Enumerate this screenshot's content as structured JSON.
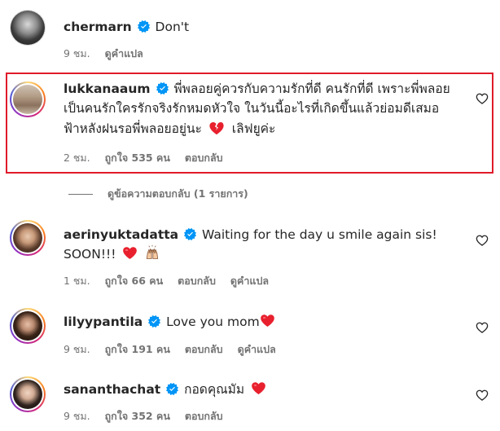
{
  "comments": [
    {
      "username": "chermarn",
      "text": "Don't",
      "time": "9 ชม.",
      "actions": [
        "ดูคำแปล"
      ]
    },
    {
      "username": "lukkanaaum",
      "text_lines": [
        "พี่พลอยคู่ควรกับความรักที่ดี คนรักที่ดี เพราะพี่พลอย",
        "เป็นคนรักใครรักจริงรักหมดหัวใจ ในวันนี้อะไรที่เกิดขึ้นแล้วย่อมดีเสมอ",
        "ฟ้าหลังฝนรอพี่พลอยอยู่นะ",
        "เลิฟยูค่ะ"
      ],
      "time": "2 ชม.",
      "likes": "ถูกใจ 535 คน",
      "actions": [
        "ตอบกลับ"
      ]
    },
    {
      "username": "aerinyuktadatta",
      "text_lines": [
        "Waiting for the day u smile again sis!",
        "SOON!!!"
      ],
      "time": "1 ชม.",
      "likes": "ถูกใจ 66 คน",
      "actions": [
        "ตอบกลับ",
        "ดูคำแปล"
      ]
    },
    {
      "username": "lilyypantila",
      "text": "Love you mom",
      "time": "9 ชม.",
      "likes": "ถูกใจ 191 คน",
      "actions": [
        "ตอบกลับ",
        "ดูคำแปล"
      ]
    },
    {
      "username": "sananthachat",
      "text": "กอดคุณมัม",
      "time": "9 ชม.",
      "likes": "ถูกใจ 352 คน",
      "actions": [
        "ตอบกลับ"
      ]
    }
  ],
  "view_replies": "ดูข้อความตอบกลับ (1 รายการ)",
  "colors": {
    "verified": "#0095f6",
    "heart": "#ed4956",
    "highlight_border": "#e01b2a",
    "meta_text": "#737373"
  },
  "icons": [
    "verified-badge-icon",
    "like-heart-icon",
    "red-heart-emoji",
    "broken-heart-emoji",
    "raised-hands-emoji"
  ]
}
